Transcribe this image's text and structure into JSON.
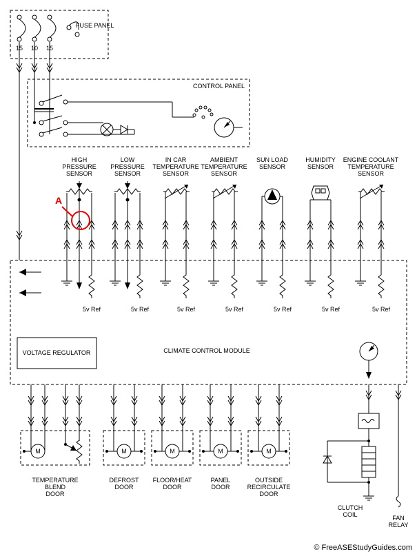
{
  "fuse_panel": {
    "title": "FUSE PANEL",
    "values": [
      "15",
      "10",
      "15"
    ]
  },
  "control_panel": {
    "title": "CONTROL PANEL"
  },
  "sensors": {
    "hp": {
      "line1": "HIGH",
      "line2": "PRESSURE",
      "line3": "SENSOR"
    },
    "lp": {
      "line1": "LOW",
      "line2": "PRESSURE",
      "line3": "SENSOR"
    },
    "in": {
      "line1": "IN CAR",
      "line2": "TEMPERATURE",
      "line3": "SENSOR"
    },
    "amb": {
      "line1": "AMBIENT",
      "line2": "TEMPERATURE",
      "line3": "SENSOR"
    },
    "sun": {
      "line1": "SUN LOAD",
      "line2": "SENSOR",
      "line3": ""
    },
    "hum": {
      "line1": "HUMIDITY",
      "line2": "SENSOR",
      "line3": ""
    },
    "ect": {
      "line1": "ENGINE COOLANT",
      "line2": "TEMPERATURE",
      "line3": "SENSOR"
    }
  },
  "five_v_ref": "5v Ref",
  "marker_a": "A",
  "voltage_regulator": "VOLTAGE REGULATOR",
  "climate_module": "CLIMATE CONTROL MODULE",
  "loads": {
    "blend": {
      "line1": "TEMPERATURE",
      "line2": "BLEND",
      "line3": "DOOR"
    },
    "defrost": {
      "line1": "DEFROST",
      "line2": "DOOR",
      "line3": ""
    },
    "floor": {
      "line1": "FLOOR/HEAT",
      "line2": "DOOR",
      "line3": ""
    },
    "panel": {
      "line1": "PANEL",
      "line2": "DOOR",
      "line3": ""
    },
    "recirc": {
      "line1": "OUTSIDE",
      "line2": "RECIRCULATE",
      "line3": "DOOR"
    }
  },
  "clutch_coil": {
    "line1": "CLUTCH",
    "line2": "COIL"
  },
  "fan_relay": {
    "line1": "FAN",
    "line2": "RELAY"
  },
  "watermark": "© FreeASEStudyGuides.com",
  "chart_data": {
    "type": "diagram",
    "title": "Automatic climate control wiring diagram",
    "fuse_panel": {
      "amp_ratings": [
        15,
        10,
        15
      ]
    },
    "modules": [
      "FUSE PANEL",
      "CONTROL PANEL",
      "VOLTAGE REGULATOR",
      "CLIMATE CONTROL MODULE"
    ],
    "sensors": [
      {
        "name": "HIGH PRESSURE SENSOR",
        "ref": "5v Ref",
        "marker": "A"
      },
      {
        "name": "LOW PRESSURE SENSOR",
        "ref": "5v Ref"
      },
      {
        "name": "IN CAR TEMPERATURE SENSOR",
        "ref": "5v Ref"
      },
      {
        "name": "AMBIENT TEMPERATURE SENSOR",
        "ref": "5v Ref"
      },
      {
        "name": "SUN LOAD SENSOR",
        "ref": "5v Ref"
      },
      {
        "name": "HUMIDITY SENSOR",
        "ref": "5v Ref"
      },
      {
        "name": "ENGINE COOLANT TEMPERATURE SENSOR",
        "ref": "5v Ref"
      }
    ],
    "actuators": [
      "TEMPERATURE BLEND DOOR",
      "DEFROST DOOR",
      "FLOOR/HEAT DOOR",
      "PANEL DOOR",
      "OUTSIDE RECIRCULATE DOOR"
    ],
    "outputs": [
      "CLUTCH COIL",
      "FAN RELAY"
    ]
  }
}
